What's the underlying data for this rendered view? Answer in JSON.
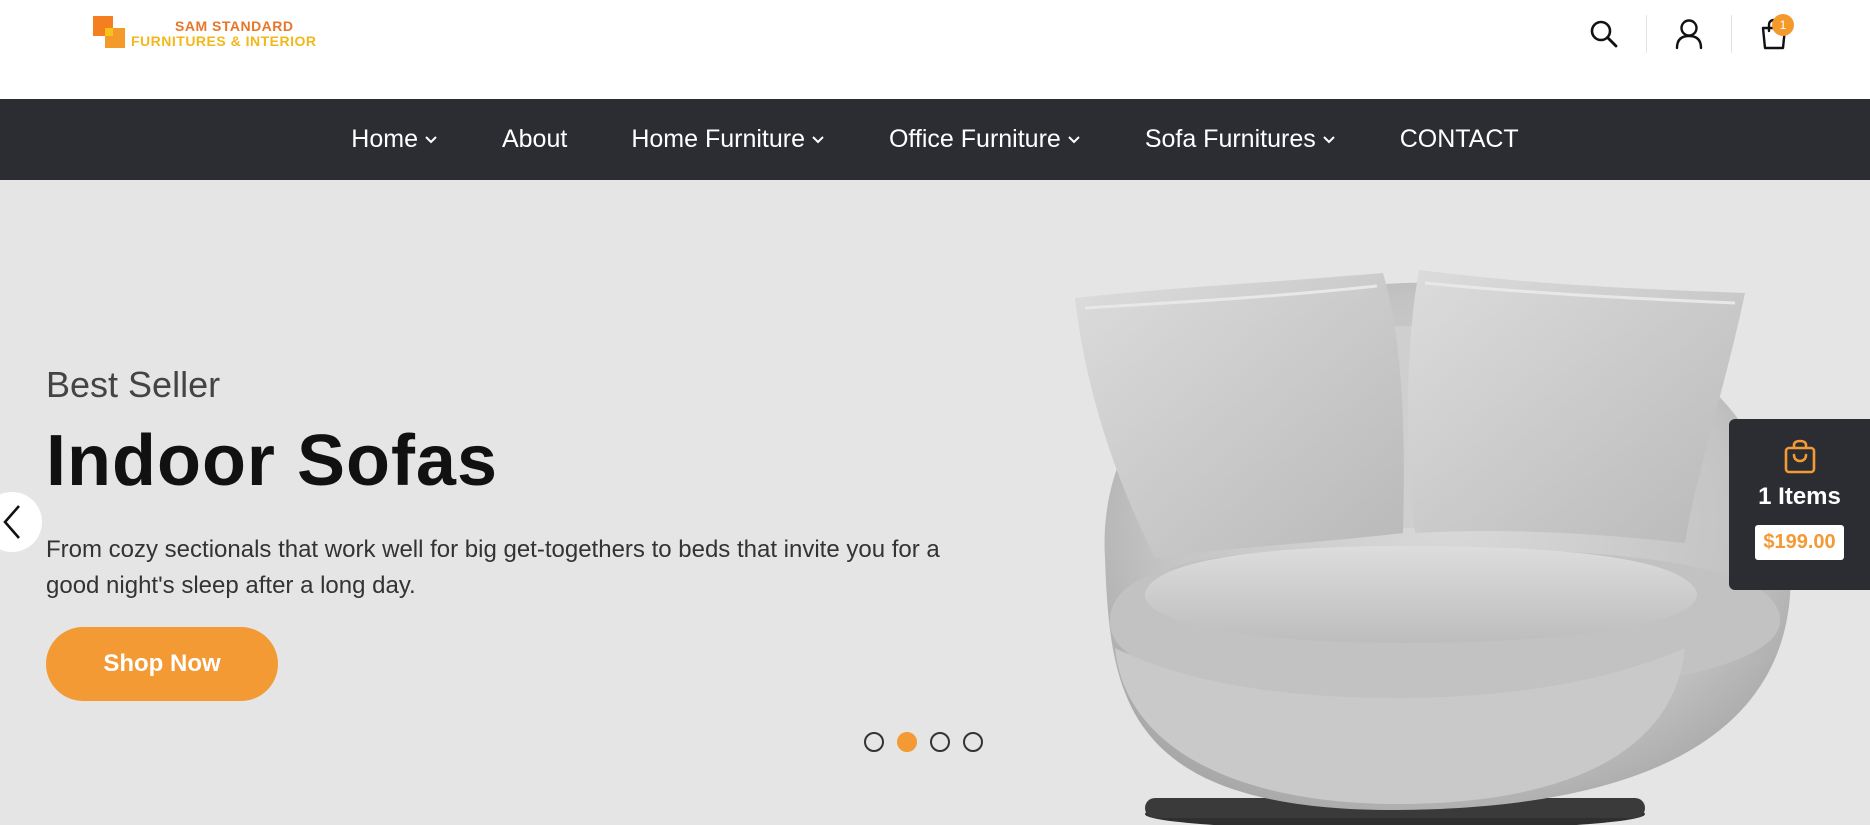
{
  "logo": {
    "line1": "SAM STANDARD",
    "line2": "FURNITURES & INTERIOR"
  },
  "header": {
    "icons": [
      "search-icon",
      "user-icon",
      "shopping-bag-icon"
    ],
    "cart_count": "1"
  },
  "nav": {
    "items": [
      {
        "label": "Home",
        "has_dropdown": true
      },
      {
        "label": "About",
        "has_dropdown": false
      },
      {
        "label": "Home Furniture",
        "has_dropdown": true
      },
      {
        "label": "Office Furniture",
        "has_dropdown": true
      },
      {
        "label": "Sofa Furnitures",
        "has_dropdown": true
      },
      {
        "label": "CONTACT",
        "has_dropdown": false
      }
    ]
  },
  "hero": {
    "subtitle": "Best Seller",
    "title": "Indoor Sofas",
    "description": "From cozy sectionals that work well for big get-togethers to beds that invite you for a good night's sleep after a long day.",
    "button_label": "Shop Now",
    "slides": 4,
    "active_slide": 2
  },
  "cart_widget": {
    "items_label": "1 Items",
    "price": "$199.00"
  },
  "colors": {
    "accent": "#f39a35",
    "nav_bg": "#2b2d33",
    "hero_bg": "#e5e5e5"
  }
}
